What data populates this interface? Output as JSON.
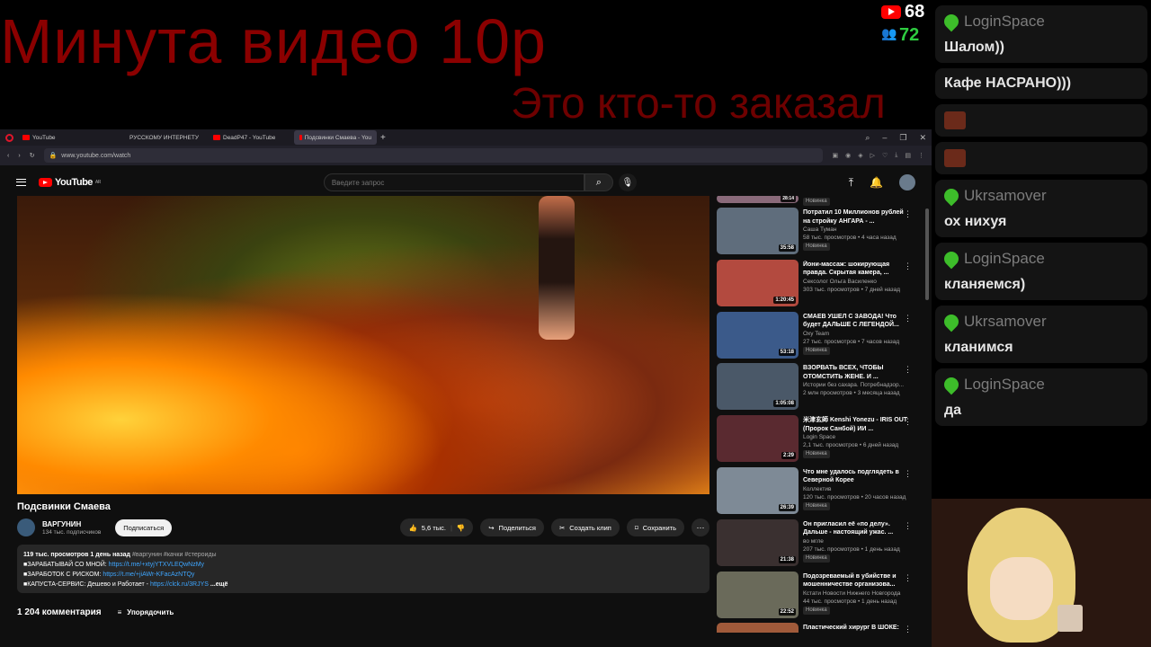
{
  "overlay": {
    "title": "Минута видео 10р",
    "subtitle": "Это кто-то заказал"
  },
  "stats": {
    "youtube_count": "68",
    "viewers_count": "72"
  },
  "chat": [
    {
      "user": "LoginSpace",
      "text": "Шалом))",
      "continued": false
    },
    {
      "user": "",
      "text": "Кафе НАСРАНО)))",
      "continued": true
    },
    {
      "user": "",
      "text": "",
      "emote": true
    },
    {
      "user": "",
      "text": "",
      "emote": true
    },
    {
      "user": "Ukrsamover",
      "text": "ох нихуя",
      "continued": false
    },
    {
      "user": "LoginSpace",
      "text": "кланяемся)",
      "continued": false
    },
    {
      "user": "Ukrsamover",
      "text": "кланимся",
      "continued": false
    },
    {
      "user": "LoginSpace",
      "text": "да",
      "continued": false
    }
  ],
  "browser": {
    "tabs": [
      "YouTube",
      "РУССКОМУ ИНТЕРНЕТУ",
      "DeadP47 - YouTube",
      "Подсвинки Смаева - You"
    ],
    "url": "www.youtube.com/watch"
  },
  "youtube": {
    "logo_text": "YouTube",
    "logo_region": "AR",
    "search_placeholder": "Введите запрос",
    "video_title": "Подсвинки Смаева",
    "channel_name": "ВАРГУНИН",
    "channel_subs": "134 тыс. подписчиков",
    "subscribe_label": "Подписаться",
    "likes": "5,6 тыс.",
    "share_label": "Поделиться",
    "clip_label": "Создать клип",
    "save_label": "Сохранить",
    "description": {
      "meta": "119 тыс. просмотров  1 день назад",
      "tags": "#варгунин #качки #стероиды",
      "line1": "■ЗАРАБАТЫВАЙ СО МНОЙ:",
      "link1": "https://t.me/+xtyjYTXVLEQwNzMy",
      "line2": "■ЗАРАБОТОК С РИСКОМ:",
      "link2": "https://t.me/+jiAWr-KFacAzNTQy",
      "line3": "■КАПУСТА-СЕРВИС: Дешево и Работает -",
      "link3": "https://clck.ru/3RJYS",
      "more": "...ещё"
    },
    "comments_count": "1 204 комментария",
    "sort_label": "Упорядочить"
  },
  "related": [
    {
      "title": "",
      "channel": "",
      "stats": "",
      "badge": "Новинка",
      "duration": "28:14",
      "color": "#8a6a7a",
      "partial": true
    },
    {
      "title": "Потратил 10 Миллионов рублей на стройку АНГАРА - ...",
      "channel": "Саша Туман",
      "stats": "58 тыс. просмотров • 4 часа назад",
      "badge": "Новинка",
      "duration": "35:58",
      "color": "#5f6d7c"
    },
    {
      "title": "Йони-массаж: шокирующая правда. Скрытая камера, ...",
      "channel": "Сексолог Ольга Василенко",
      "stats": "303 тыс. просмотров • 7 дней назад",
      "badge": "",
      "duration": "1:20:45",
      "color": "#b34a3f"
    },
    {
      "title": "СМАЕВ УШЕЛ С ЗАВОДА! Что будет ДАЛЬШЕ С ЛЕГЕНДОЙ...",
      "channel": "Oxy Team",
      "stats": "27 тыс. просмотров • 7 часов назад",
      "badge": "Новинка",
      "duration": "53:18",
      "color": "#3b5a8a"
    },
    {
      "title": "ВЗОРВАТЬ ВСЕХ, ЧТОБЫ ОТОМСТИТЬ ЖЕНЕ. И ...",
      "channel": "Истории без сахара. Потребнадзор...",
      "stats": "2 млн просмотров • 3 месяца назад",
      "badge": "",
      "duration": "1:05:08",
      "color": "#4a5868"
    },
    {
      "title": "米津玄師 Kenshi Yonezu - IRIS OUT (Пророк Санбой) ИИ ...",
      "channel": "Login Space",
      "stats": "2,1 тыс. просмотров • 6 дней назад",
      "badge": "Новинка",
      "duration": "2:29",
      "color": "#5a2a30"
    },
    {
      "title": "Что мне удалось подглядеть в Северной Корее",
      "channel": "Коллектив",
      "stats": "120 тыс. просмотров • 20 часов назад",
      "badge": "Новинка",
      "duration": "26:39",
      "color": "#7e8a96"
    },
    {
      "title": "Он пригласил её «по делу». Дальше - настоящий ужас. ...",
      "channel": "во мгле",
      "stats": "207 тыс. просмотров • 1 день назад",
      "badge": "Новинка",
      "duration": "21:38",
      "color": "#3a3030"
    },
    {
      "title": "Подозреваемый в убийстве и мошенничестве организова...",
      "channel": "Кстати Новости Нижнего Новгорода",
      "stats": "44 тыс. просмотров • 1 день назад",
      "badge": "Новинка",
      "duration": "22:52",
      "color": "#6a6a5a"
    },
    {
      "title": "Пластический хирург В ШОКЕ:",
      "channel": "",
      "stats": "",
      "badge": "",
      "duration": "",
      "color": "#a05a3a"
    }
  ]
}
